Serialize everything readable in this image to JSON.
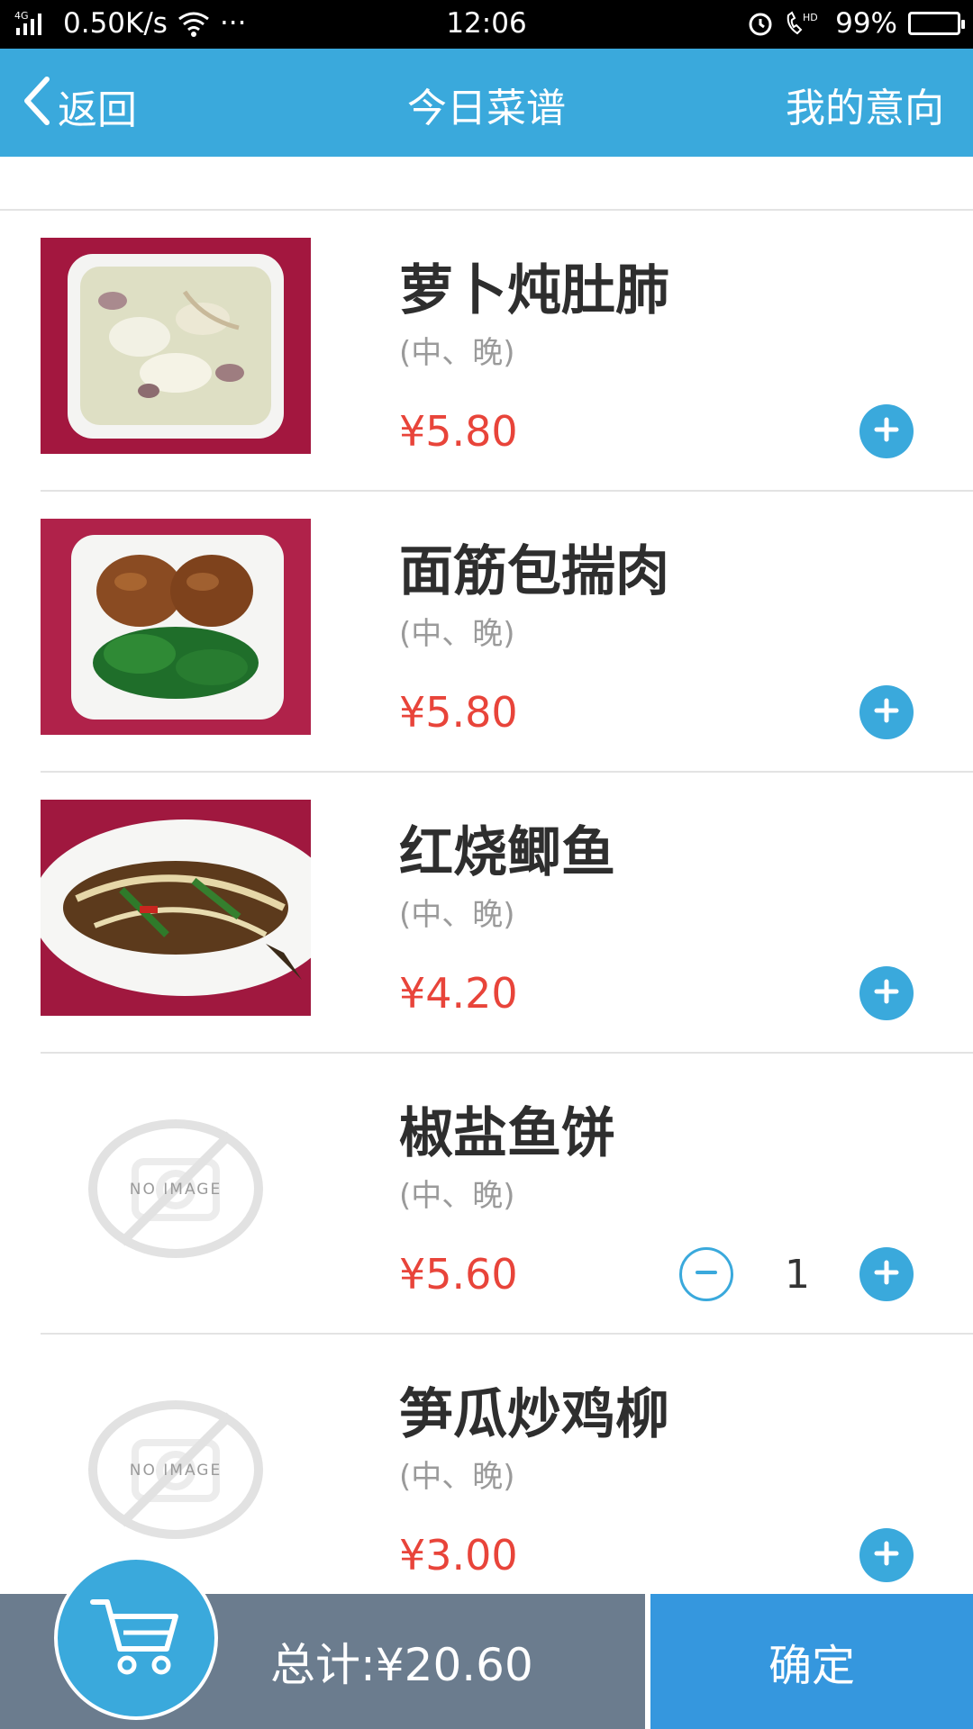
{
  "status_bar": {
    "network": "4G",
    "speed": "0.50K/s",
    "more": "···",
    "time": "12:06",
    "hd": "HD",
    "battery": "99%",
    "battery_level": 0.99
  },
  "header": {
    "back_label": "返回",
    "title": "今日菜谱",
    "right_label": "我的意向"
  },
  "menu": {
    "items": [
      {
        "name": "萝卜炖肚肺",
        "meal": "(中、晚)",
        "price": "¥5.80",
        "image": "photo",
        "quantity": null
      },
      {
        "name": "面筋包揣肉",
        "meal": "(中、晚)",
        "price": "¥5.80",
        "image": "photo",
        "quantity": null
      },
      {
        "name": "红烧鲫鱼",
        "meal": "(中、晚)",
        "price": "¥4.20",
        "image": "photo",
        "quantity": null
      },
      {
        "name": "椒盐鱼饼",
        "meal": "(中、晚)",
        "price": "¥5.60",
        "image": "none",
        "quantity": "1"
      },
      {
        "name": "笋瓜炒鸡柳",
        "meal": "(中、晚)",
        "price": "¥3.00",
        "image": "none",
        "quantity": null
      }
    ],
    "no_image_text": "NO IMAGE"
  },
  "footer": {
    "total": "总计:¥20.60",
    "confirm_label": "确定"
  },
  "colors": {
    "accent": "#3aa9dc",
    "price": "#e8443a",
    "footer_left": "#6b7c8e",
    "confirm": "#3597de"
  }
}
